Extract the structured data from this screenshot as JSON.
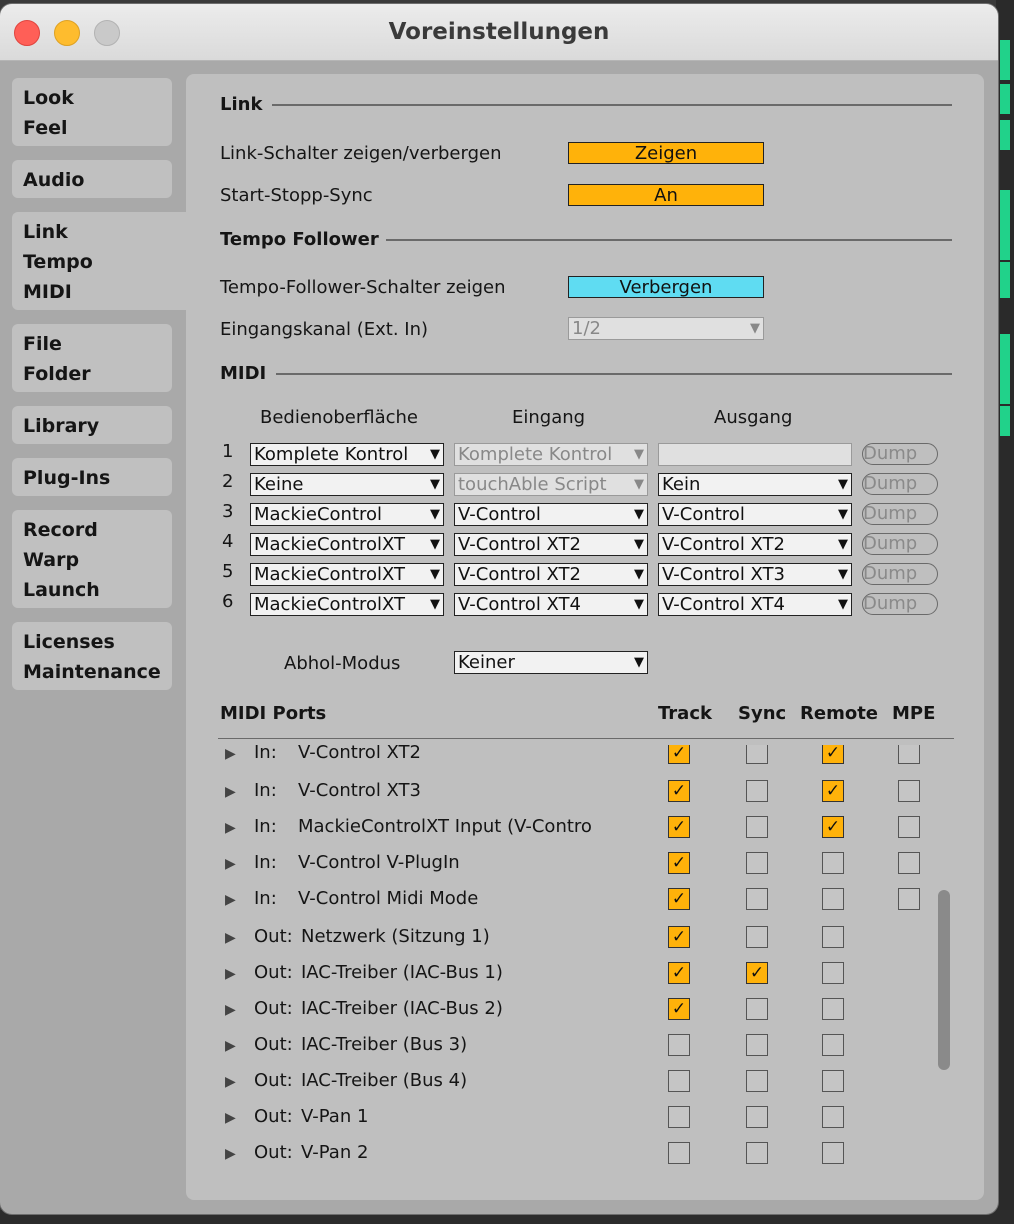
{
  "window": {
    "title": "Voreinstellungen"
  },
  "sidebar": {
    "tabs": [
      {
        "lines": [
          "Look",
          "Feel"
        ]
      },
      {
        "lines": [
          "Audio"
        ]
      },
      {
        "lines": [
          "Link",
          "Tempo",
          "MIDI"
        ]
      },
      {
        "lines": [
          "File",
          "Folder"
        ]
      },
      {
        "lines": [
          "Library"
        ]
      },
      {
        "lines": [
          "Plug-Ins"
        ]
      },
      {
        "lines": [
          "Record",
          "Warp",
          "Launch"
        ]
      },
      {
        "lines": [
          "Licenses",
          "Maintenance"
        ]
      }
    ],
    "active": "Link / Tempo / MIDI"
  },
  "link": {
    "heading": "Link",
    "show_toggle_label": "Link-Schalter zeigen/verbergen",
    "show_toggle_value": "Zeigen",
    "start_stop_label": "Start-Stopp-Sync",
    "start_stop_value": "An"
  },
  "tempo_follower": {
    "heading": "Tempo Follower",
    "show_label": "Tempo-Follower-Schalter zeigen",
    "show_value": "Verbergen",
    "input_label": "Eingangskanal (Ext. In)",
    "input_value": "1/2"
  },
  "midi": {
    "heading": "MIDI",
    "col_surface": "Bedienoberfläche",
    "col_input": "Eingang",
    "col_output": "Ausgang",
    "dump_label": "Dump",
    "rows": [
      {
        "num": "1",
        "surface": "Komplete Kontrol",
        "input": "Komplete Kontrol",
        "output": ""
      },
      {
        "num": "2",
        "surface": "Keine",
        "input": "touchAble Script",
        "output": "Kein"
      },
      {
        "num": "3",
        "surface": "MackieControl",
        "input": "V-Control",
        "output": "V-Control"
      },
      {
        "num": "4",
        "surface": "MackieControlXT",
        "input": "V-Control XT2",
        "output": "V-Control XT2"
      },
      {
        "num": "5",
        "surface": "MackieControlXT",
        "input": "V-Control XT2",
        "output": "V-Control XT3"
      },
      {
        "num": "6",
        "surface": "MackieControlXT",
        "input": "V-Control XT4",
        "output": "V-Control XT4"
      }
    ],
    "pickup_label": "Abhol-Modus",
    "pickup_value": "Keiner"
  },
  "ports": {
    "heading": "MIDI Ports",
    "col_track": "Track",
    "col_sync": "Sync",
    "col_remote": "Remote",
    "col_mpe": "MPE",
    "rows": [
      {
        "dir": "In:",
        "name": "V-Control XT2",
        "track": true,
        "sync": false,
        "remote": true,
        "mpe": false
      },
      {
        "dir": "In:",
        "name": "V-Control XT3",
        "track": true,
        "sync": false,
        "remote": true,
        "mpe": false
      },
      {
        "dir": "In:",
        "name": "MackieControlXT Input (V-Contro",
        "track": true,
        "sync": false,
        "remote": true,
        "mpe": false
      },
      {
        "dir": "In:",
        "name": "V-Control V-PlugIn",
        "track": true,
        "sync": false,
        "remote": false,
        "mpe": false
      },
      {
        "dir": "In:",
        "name": "V-Control Midi Mode",
        "track": true,
        "sync": false,
        "remote": false,
        "mpe": false
      },
      {
        "dir": "Out:",
        "name": "Netzwerk (Sitzung 1)",
        "track": true,
        "sync": false,
        "remote": false,
        "mpe": null
      },
      {
        "dir": "Out:",
        "name": "IAC-Treiber (IAC-Bus 1)",
        "track": true,
        "sync": true,
        "remote": false,
        "mpe": null
      },
      {
        "dir": "Out:",
        "name": "IAC-Treiber (IAC-Bus 2)",
        "track": true,
        "sync": false,
        "remote": false,
        "mpe": null
      },
      {
        "dir": "Out:",
        "name": "IAC-Treiber (Bus 3)",
        "track": false,
        "sync": false,
        "remote": false,
        "mpe": null
      },
      {
        "dir": "Out:",
        "name": "IAC-Treiber (Bus 4)",
        "track": false,
        "sync": false,
        "remote": false,
        "mpe": null
      },
      {
        "dir": "Out:",
        "name": "V-Pan 1",
        "track": false,
        "sync": false,
        "remote": false,
        "mpe": null
      },
      {
        "dir": "Out:",
        "name": "V-Pan 2",
        "track": false,
        "sync": false,
        "remote": false,
        "mpe": null
      }
    ]
  },
  "icons": {
    "dropdown": "triangle-down-icon",
    "expand": "triangle-right-icon",
    "check": "checkmark-icon"
  },
  "colors": {
    "toggle_on": "#ffb20a",
    "toggle_off": "#5fdcf2",
    "panel": "#bfbfbf",
    "sidebar": "#a9a9a9"
  }
}
